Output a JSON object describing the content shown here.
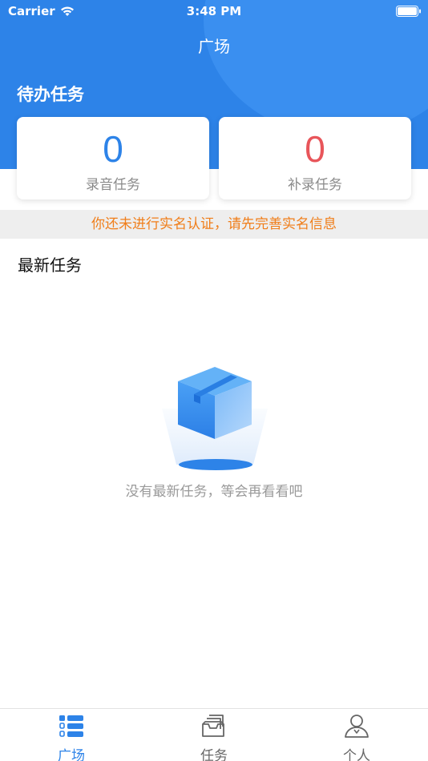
{
  "status_bar": {
    "carrier": "Carrier",
    "time": "3:48 PM"
  },
  "nav": {
    "title": "广场"
  },
  "todo": {
    "title": "待办任务",
    "cards": [
      {
        "count": "0",
        "label": "录音任务",
        "color": "#2d83e8"
      },
      {
        "count": "0",
        "label": "补录任务",
        "color": "#e8555a"
      }
    ]
  },
  "notice": {
    "text": "你还未进行实名认证，请先完善实名信息"
  },
  "latest": {
    "title": "最新任务",
    "empty_text": "没有最新任务，等会再看看吧"
  },
  "tabbar": {
    "items": [
      {
        "label": "广场",
        "icon": "list-icon",
        "active": true
      },
      {
        "label": "任务",
        "icon": "inbox-stack-icon",
        "active": false
      },
      {
        "label": "个人",
        "icon": "person-icon",
        "active": false
      }
    ]
  },
  "colors": {
    "primary": "#2d83e8",
    "notice": "#f07e1a",
    "danger": "#e8555a"
  }
}
